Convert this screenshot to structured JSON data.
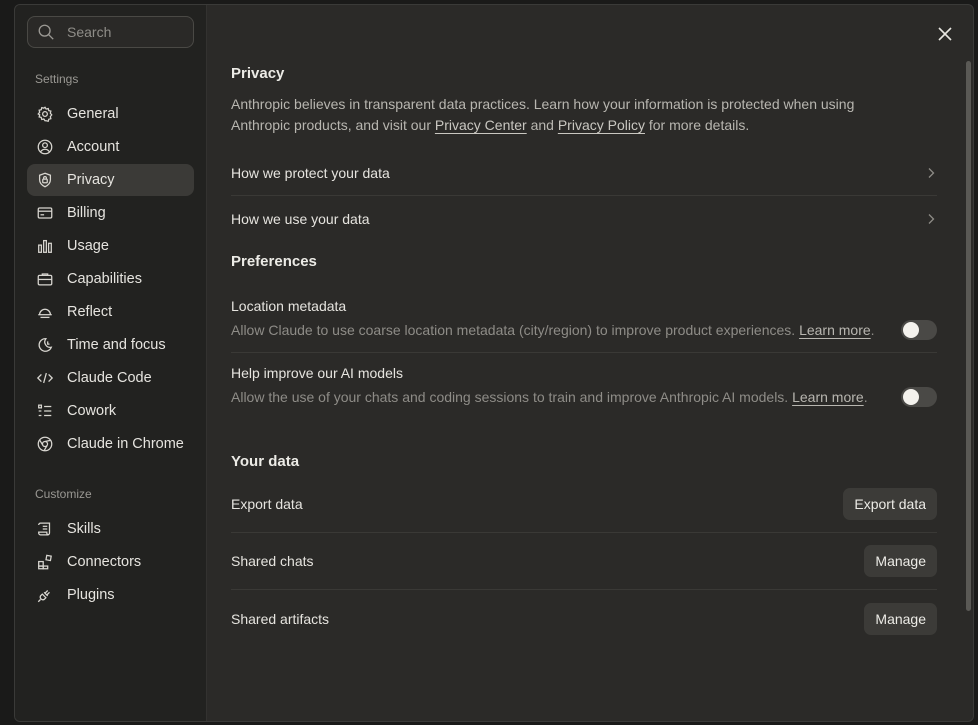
{
  "search": {
    "placeholder": "Search"
  },
  "sidebar": {
    "settings_label": "Settings",
    "items": [
      {
        "label": "General",
        "icon": "gear-icon"
      },
      {
        "label": "Account",
        "icon": "user-circle-icon"
      },
      {
        "label": "Privacy",
        "icon": "shield-lock-icon",
        "active": true
      },
      {
        "label": "Billing",
        "icon": "credit-card-icon"
      },
      {
        "label": "Usage",
        "icon": "bar-chart-icon"
      },
      {
        "label": "Capabilities",
        "icon": "briefcase-icon"
      },
      {
        "label": "Reflect",
        "icon": "bell-dome-icon"
      },
      {
        "label": "Time and focus",
        "icon": "moon-clock-icon"
      },
      {
        "label": "Claude Code",
        "icon": "code-icon"
      },
      {
        "label": "Cowork",
        "icon": "checklist-icon"
      },
      {
        "label": "Claude in Chrome",
        "icon": "globe-icon"
      }
    ],
    "customize_label": "Customize",
    "customize_items": [
      {
        "label": "Skills",
        "icon": "scroll-icon"
      },
      {
        "label": "Connectors",
        "icon": "blocks-icon"
      },
      {
        "label": "Plugins",
        "icon": "plug-icon"
      }
    ]
  },
  "privacy": {
    "title": "Privacy",
    "intro_before": "Anthropic believes in transparent data practices. Learn how your information is protected when using Anthropic products, and visit our ",
    "privacy_center": "Privacy Center",
    "intro_and": " and ",
    "privacy_policy": "Privacy Policy",
    "intro_after": " for more details.",
    "links": [
      "How we protect your data",
      "How we use your data"
    ]
  },
  "preferences": {
    "title": "Preferences",
    "items": [
      {
        "title": "Location metadata",
        "desc": "Allow Claude to use coarse location metadata (city/region) to improve product experiences. ",
        "learn": "Learn more",
        "enabled": false
      },
      {
        "title": "Help improve our AI models",
        "desc": "Allow the use of your chats and coding sessions to train and improve Anthropic AI models. ",
        "learn": "Learn more",
        "enabled": false
      }
    ]
  },
  "your_data": {
    "title": "Your data",
    "rows": [
      {
        "label": "Export data",
        "button": "Export data"
      },
      {
        "label": "Shared chats",
        "button": "Manage"
      },
      {
        "label": "Shared artifacts",
        "button": "Manage"
      }
    ]
  }
}
